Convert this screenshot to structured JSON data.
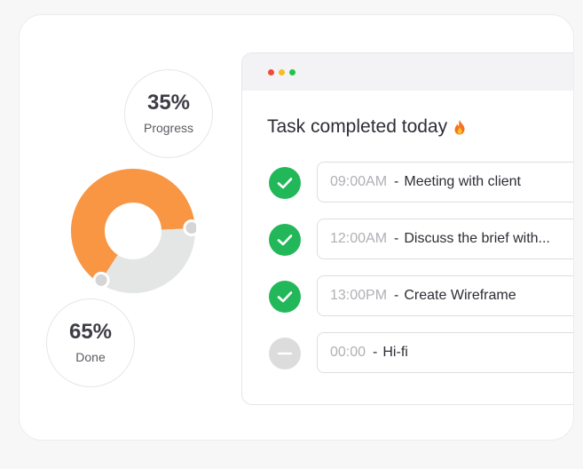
{
  "stats": {
    "progress": {
      "value": "35%",
      "label": "Progress",
      "fraction": 0.35
    },
    "done": {
      "value": "65%",
      "label": "Done",
      "fraction": 0.65
    }
  },
  "colors": {
    "done": "#f89643",
    "progress": "#e3e6e5",
    "check": "#22b85a",
    "pending": "#dcdcdc"
  },
  "window": {
    "title": "Task completed today"
  },
  "tasks": [
    {
      "time": "09:00AM",
      "separator": "-",
      "name": "Meeting with client",
      "status": "completed"
    },
    {
      "time": "12:00AM",
      "separator": "-",
      "name": "Discuss the brief with...",
      "status": "completed"
    },
    {
      "time": "13:00PM",
      "separator": "-",
      "name": "Create Wireframe",
      "status": "completed"
    },
    {
      "time": "00:00",
      "separator": "-",
      "name": "Hi-fi",
      "status": "pending"
    }
  ]
}
